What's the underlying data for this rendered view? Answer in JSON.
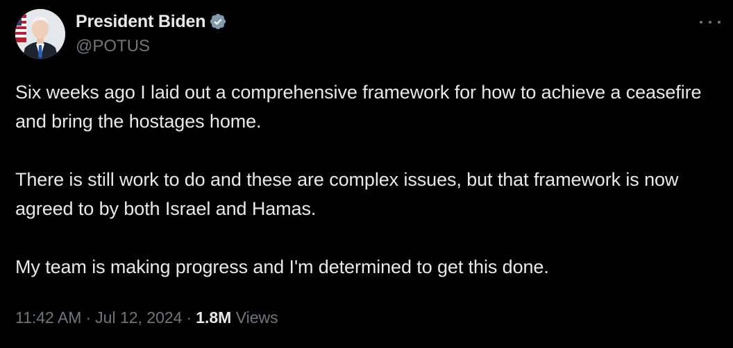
{
  "author": {
    "name": "President Biden",
    "handle": "@POTUS",
    "verified_color": "#829aab"
  },
  "tweet": {
    "paragraphs": [
      "Six weeks ago I laid out a comprehensive framework for how to achieve a ceasefire and bring the hostages home.",
      "There is still work to do and these are complex issues, but that framework is now agreed to by both Israel and Hamas.",
      "My team is making progress and I'm determined to get this done."
    ]
  },
  "meta": {
    "time": "11:42 AM",
    "separator": "·",
    "date": "Jul 12, 2024",
    "views_count": "1.8M",
    "views_label": "Views"
  },
  "icons": {
    "more": "more-horizontal-icon",
    "verified": "verified-badge-icon"
  },
  "colors": {
    "background": "#000000",
    "text_primary": "#e7e9ea",
    "text_secondary": "#71767b"
  }
}
